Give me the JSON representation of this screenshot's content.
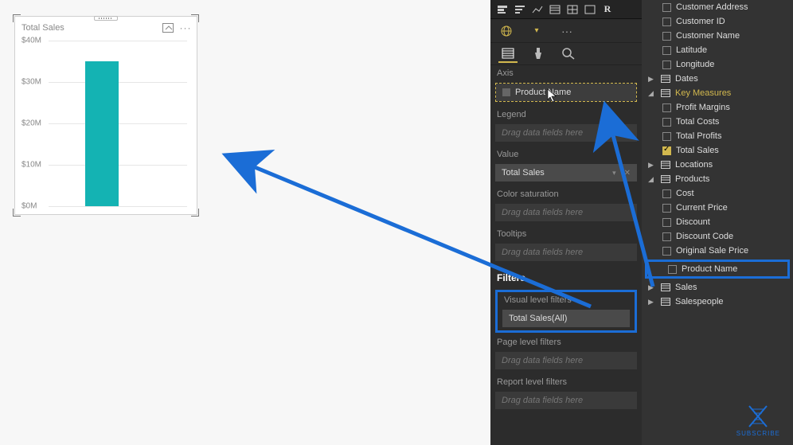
{
  "chart": {
    "title": "Total Sales",
    "ylabels": [
      "$40M",
      "$30M",
      "$20M",
      "$10M",
      "$0M"
    ]
  },
  "chart_data": {
    "type": "bar",
    "categories": [
      ""
    ],
    "values": [
      35000000
    ],
    "title": "Total Sales",
    "xlabel": "",
    "ylabel": "",
    "ylim": [
      0,
      40000000
    ],
    "yticks": [
      0,
      10000000,
      20000000,
      30000000,
      40000000
    ],
    "ytick_labels": [
      "$0M",
      "$10M",
      "$20M",
      "$30M",
      "$40M"
    ]
  },
  "viz": {
    "tabs": {
      "fields": "Fields",
      "format": "Format",
      "analytics": "Analytics"
    },
    "sections": {
      "axis": "Axis",
      "legend": "Legend",
      "value": "Value",
      "color": "Color saturation",
      "tooltips": "Tooltips"
    },
    "drop_placeholder": "Drag data fields here",
    "axis_field": "Product Name",
    "value_field": "Total Sales",
    "filters_header": "Filters",
    "visual_filters_label": "Visual level filters",
    "visual_filter_item": "Total Sales(All)",
    "page_filters_label": "Page level filters",
    "report_filters_label": "Report level filters"
  },
  "fields": {
    "customers_children": [
      "Customer Address",
      "Customer ID",
      "Customer Name",
      "Latitude",
      "Longitude"
    ],
    "dates": "Dates",
    "key_measures": "Key Measures",
    "key_children": [
      "Profit Margins",
      "Total Costs",
      "Total Profits",
      "Total Sales"
    ],
    "locations": "Locations",
    "products": "Products",
    "products_children": [
      "Cost",
      "Current Price",
      "Discount",
      "Discount Code",
      "Original Sale Price"
    ],
    "product_name": "Product Name",
    "sales": "Sales",
    "salespeople": "Salespeople"
  },
  "subscribe": "SUBSCRIBE"
}
